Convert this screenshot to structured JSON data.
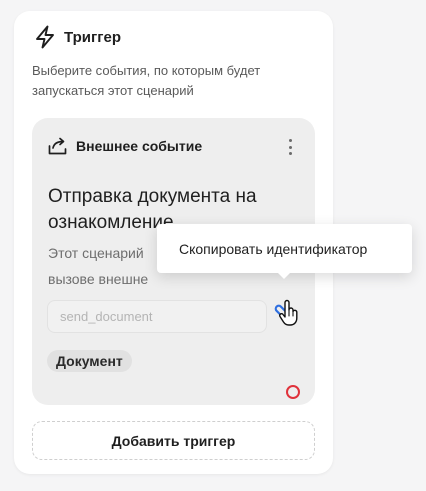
{
  "trigger_panel": {
    "title": "Триггер",
    "description": "Выберите события, по которым будет запускаться этот сценарий",
    "icon": "bolt-icon"
  },
  "event_card": {
    "type_label": "Внешнее событие",
    "type_icon": "share-icon",
    "title": "Отправка документа на ознакомление",
    "description": "Этот сценарий\nвызове внешне",
    "identifier_placeholder": "send_document",
    "tag": "Документ",
    "status_color": "#e0323b"
  },
  "tooltip": {
    "text": "Скопировать идентификатор"
  },
  "add_trigger_label": "Добавить триггер",
  "colors": {
    "accent": "#2f6fe0",
    "status": "#e0323b"
  }
}
